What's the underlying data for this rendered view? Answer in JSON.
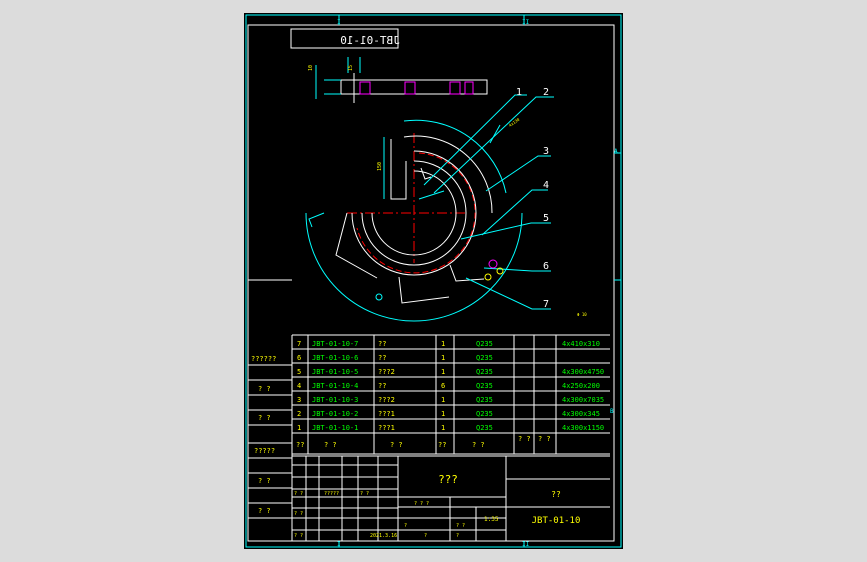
{
  "drawing": {
    "code_box": "JBT-01-10",
    "code_box_mirrored": true,
    "part_numbers": [
      "1",
      "2",
      "3",
      "4",
      "5",
      "6",
      "7"
    ],
    "zone_marks": {
      "top": [
        "I",
        "II"
      ],
      "bottom": [
        "I",
        "II"
      ],
      "right": [
        "A",
        "B"
      ]
    },
    "side_note": "Φ 10",
    "dims": [
      "150",
      "4x130"
    ]
  },
  "bom": {
    "rows": [
      {
        "no": "7",
        "code": "JBT-01-10-7",
        "name": "??",
        "qty": "1",
        "mat": "Q235",
        "note": "4x410x310"
      },
      {
        "no": "6",
        "code": "JBT-01-10-6",
        "name": "??",
        "qty": "1",
        "mat": "Q235",
        "note": ""
      },
      {
        "no": "5",
        "code": "JBT-01-10-5",
        "name": "???2",
        "qty": "1",
        "mat": "Q235",
        "note": "4x300x4750"
      },
      {
        "no": "4",
        "code": "JBT-01-10-4",
        "name": "??",
        "qty": "6",
        "mat": "Q235",
        "note": "4x250x200"
      },
      {
        "no": "3",
        "code": "JBT-01-10-3",
        "name": "???2",
        "qty": "1",
        "mat": "Q235",
        "note": "4x300x7035"
      },
      {
        "no": "2",
        "code": "JBT-01-10-2",
        "name": "???1",
        "qty": "1",
        "mat": "Q235",
        "note": "4x300x345"
      },
      {
        "no": "1",
        "code": "JBT-01-10-1",
        "name": "???1",
        "qty": "1",
        "mat": "Q235",
        "note": "4x300x1150"
      }
    ],
    "header": {
      "no": "??",
      "code": "?  ?",
      "name": "?  ?",
      "qty": "??",
      "mat": "?  ?",
      "c1": "? ?",
      "c2": "? ?"
    }
  },
  "side_labels": [
    "??????",
    "?  ?",
    "?  ?",
    "?????",
    "?  ?",
    "?  ?"
  ],
  "title_block": {
    "name": "???",
    "org": "??",
    "drawing_no": "JBT-01-10",
    "scale": "1:35",
    "date": "2021.3.16",
    "misc": [
      "?  ?",
      "?????",
      "?  ?",
      "?  ?",
      "?  ?",
      "? ? ?",
      "?",
      "?",
      "?  ?",
      "?"
    ]
  }
}
